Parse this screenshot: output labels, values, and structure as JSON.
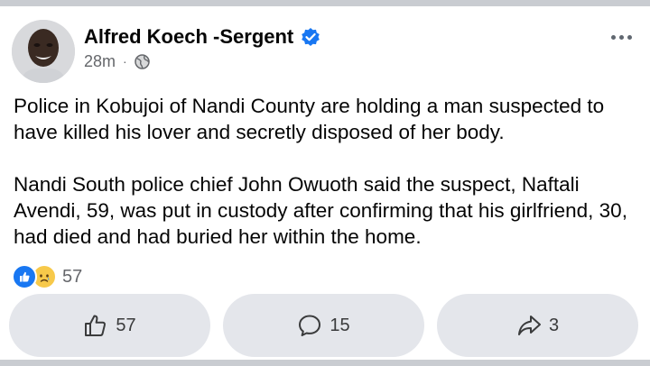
{
  "post": {
    "author": "Alfred Koech -Sergent",
    "time": "28m",
    "separator": "·",
    "paragraphs": [
      "Police in Kobujoi of Nandi County are holding a man suspected to have killed his lover and secretly disposed of her body.",
      "Nandi South police chief John Owuoth said the suspect, Naftali Avendi, 59, was put in custody after confirming that his girlfriend, 30, had died and had buried her within the home."
    ],
    "reactions_count": "57"
  },
  "actions": {
    "like_count": "57",
    "comment_count": "15",
    "share_count": "3"
  },
  "icons": {
    "verified": "verified-badge-icon",
    "privacy": "globe-icon",
    "more": "more-options-icon",
    "like": "thumbs-up-icon",
    "comment": "comment-icon",
    "share": "share-arrow-icon"
  },
  "colors": {
    "accent": "#1877f2",
    "text": "#050505",
    "muted": "#65676b",
    "button_bg": "#e4e6eb"
  }
}
